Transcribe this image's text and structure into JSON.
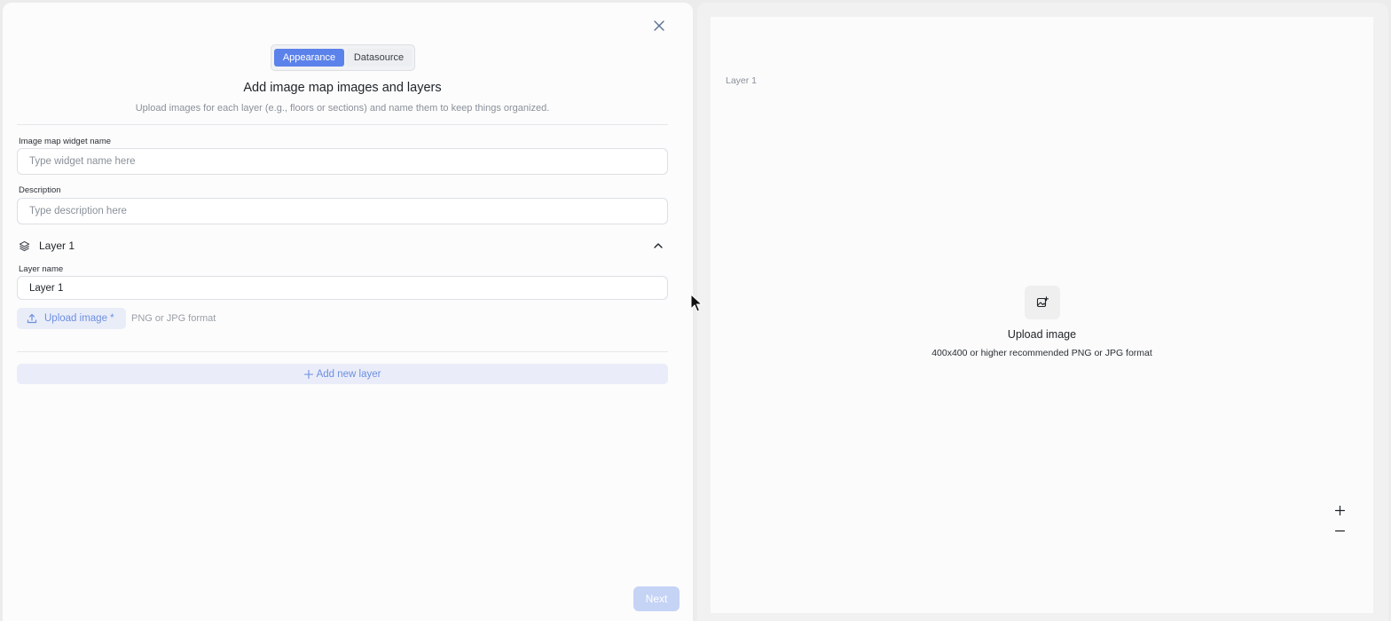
{
  "tabs": {
    "appearance": "Appearance",
    "datasource": "Datasource",
    "active": "Appearance"
  },
  "header": {
    "title": "Add image map images and layers",
    "subtitle": "Upload images for each layer (e.g., floors or sections) and name them to keep things organized."
  },
  "form": {
    "widget_name": {
      "label": "Image map widget name",
      "placeholder": "Type widget name here",
      "value": ""
    },
    "description": {
      "label": "Description",
      "placeholder": "Type description here",
      "value": ""
    }
  },
  "layer": {
    "title": "Layer 1",
    "name_label": "Layer name",
    "name_value": "Layer 1",
    "upload_label": "Upload image *",
    "upload_hint": "PNG or JPG format"
  },
  "add_layer_label": "Add new layer",
  "next_label": "Next",
  "preview": {
    "layer_label": "Layer 1",
    "upload_title": "Upload image",
    "upload_subtitle": "400x400 or higher recommended PNG or JPG format",
    "zoom_in": "+",
    "zoom_out": "−"
  },
  "colors": {
    "accent": "#5b82ea",
    "accent_soft": "#e9edf8",
    "next_disabled": "#c5d3f5"
  },
  "icons": [
    "close-icon",
    "layers-icon",
    "chevron-up-icon",
    "upload-icon",
    "plus-icon",
    "image-upload-icon",
    "zoom-in-icon",
    "zoom-out-icon",
    "mouse-cursor-icon"
  ]
}
